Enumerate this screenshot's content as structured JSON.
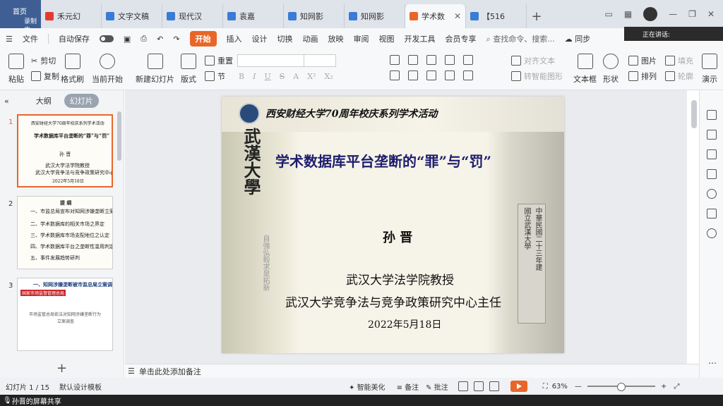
{
  "tabs": {
    "home": {
      "label": "首页",
      "sub": "录制中"
    },
    "docs": [
      {
        "label": "禾元幻",
        "color": "#e23b2f"
      },
      {
        "label": "文字文稿",
        "color": "#3a7bd5"
      },
      {
        "label": "现代汉",
        "color": "#3a7bd5"
      },
      {
        "label": "袁嘉",
        "color": "#3a7bd5"
      },
      {
        "label": "知网影",
        "color": "#3a7bd5"
      },
      {
        "label": "知网影",
        "color": "#3a7bd5"
      },
      {
        "label": "学术数",
        "color": "#e8662a"
      },
      {
        "label": "【516",
        "color": "#3a7bd5"
      }
    ]
  },
  "menu": {
    "file": "文件",
    "autosave": "自动保存",
    "items": [
      "开始",
      "插入",
      "设计",
      "切换",
      "动画",
      "放映",
      "审阅",
      "视图",
      "开发工具",
      "会员专享"
    ],
    "search": "查找命令、搜索...",
    "sync": "同步",
    "speaking": "正在讲话:"
  },
  "ribbon": {
    "paste": "粘贴",
    "cut": "剪切",
    "copy": "复制",
    "format_painter": "格式刷",
    "from_current": "当前开始",
    "new_slide": "新建幻灯片",
    "layout": "版式",
    "reset": "重置",
    "section": "节",
    "text_box": "文本框",
    "shape": "形状",
    "picture": "图片",
    "arrange": "排列",
    "fill": "填充",
    "outline": "轮廓",
    "align_text": "对齐文本",
    "convert_smartart": "转智能图形",
    "present": "演示"
  },
  "leftpanel": {
    "outline": "大纲",
    "slides": "幻灯片",
    "thumbs": [
      {
        "num": "1",
        "lines": [
          "西安财经大学70周年校庆系列学术活动",
          "学术数据库平台垄断的“罪”与“罚”",
          "孙  晋",
          "武汉大学法学院教授",
          "武汉大学竞争法与竞争政策研究中心主任",
          "2022年5月18日"
        ]
      },
      {
        "num": "2",
        "lines": [
          "提  纲",
          "一、市监总局宣布对知网涉嫌垄断立案调查",
          "二、学术数据库的相关市场之界定",
          "三、学术数据库市场支配地位之认定",
          "四、学术数据库平台之垄断性滥用判定",
          "五、事件发展趋势研判"
        ]
      },
      {
        "num": "3",
        "lines": [
          "一、知网涉嫌垄断被市监总局立案调查",
          "国家市场监督管理总局",
          "市场监管总局依法对知网涉嫌垄断行为",
          "立案调查"
        ]
      }
    ]
  },
  "slide": {
    "header": "西安财经大学70周年校庆系列学术活动",
    "title": "学术数据库平台垄断的“罪”与“罚”",
    "presenter": "孙  晋",
    "role1": "武汉大学法学院教授",
    "role2": "武汉大学竞争法与竞争政策研究中心主任",
    "date": "2022年5月18日",
    "calligraphy": "武漢大學",
    "motto": "自強弘毅求是拓新",
    "pillar_left": "國立武漢大學",
    "pillar_right": "中華民國二十三年建"
  },
  "notes": {
    "placeholder": "单击此处添加备注"
  },
  "status": {
    "slide_pos": "幻灯片 1 / 15",
    "template": "默认设计模板",
    "smart": "智能美化",
    "notes": "备注",
    "comment": "批注",
    "zoom": "63%"
  },
  "share": {
    "label": "孙晋的屏幕共享"
  }
}
